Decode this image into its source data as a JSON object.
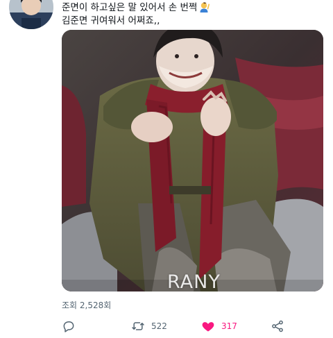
{
  "tweet": {
    "text_line_1": "준면이 하고싶은 말 있어서 손 번쩍",
    "text_line_2": "김준면 귀여워서 어쩌죠,,",
    "emoji": "person-raising-hand-emoji"
  },
  "media": {
    "watermark": "RANY"
  },
  "stats": {
    "views": "조회 2,528회"
  },
  "actions": {
    "reply_icon": "speech-bubble-icon",
    "retweet_icon": "retweet-arrows-icon",
    "retweet_count": "522",
    "like_icon": "heart-filled-icon",
    "like_count": "317",
    "like_color": "#f91880",
    "share_icon": "share-nodes-icon"
  },
  "colors": {
    "muted_text": "#536471",
    "like_pink": "#f91880"
  }
}
